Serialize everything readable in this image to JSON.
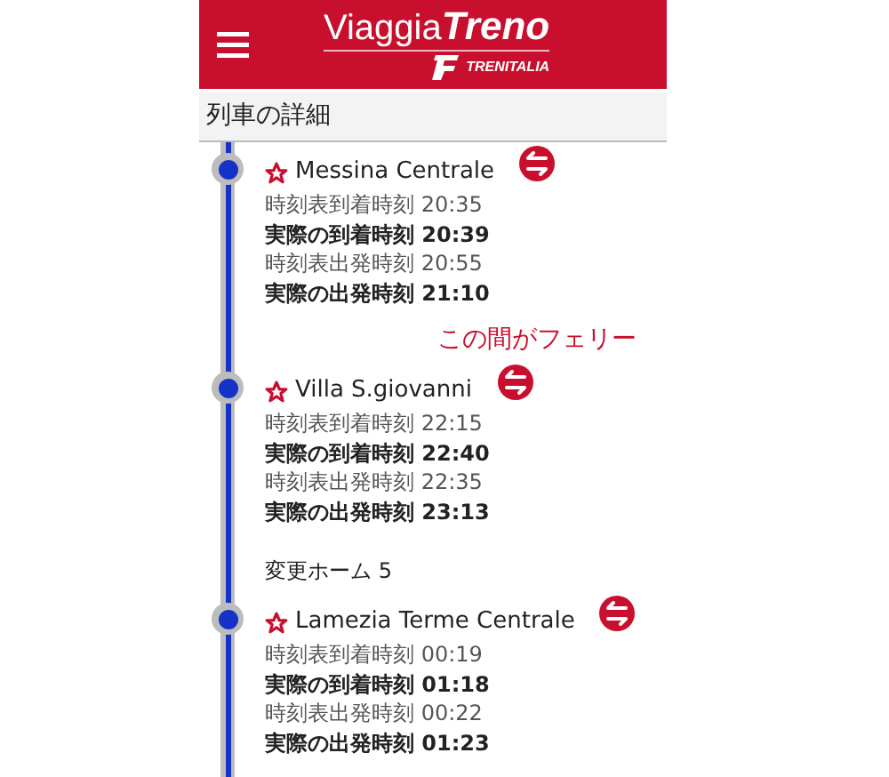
{
  "header": {
    "logo_main": "Viaggia",
    "logo_bold": "Treno",
    "logo_sub": "TRENITALIA"
  },
  "section_title": "列車の詳細",
  "stops": [
    {
      "name": "Messina Centrale",
      "lines": [
        {
          "kind": "scheduled",
          "text": "時刻表到着時刻 20:35"
        },
        {
          "kind": "actual",
          "text": "実際の到着時刻 20:39"
        },
        {
          "kind": "scheduled",
          "text": "時刻表出発時刻 20:55"
        },
        {
          "kind": "actual",
          "text": "実際の出発時刻 21:10"
        }
      ],
      "note": "この間がフェリー"
    },
    {
      "name": "Villa S.giovanni",
      "lines": [
        {
          "kind": "scheduled",
          "text": "時刻表到着時刻 22:15"
        },
        {
          "kind": "actual",
          "text": "実際の到着時刻 22:40"
        },
        {
          "kind": "scheduled",
          "text": "時刻表出発時刻 22:35"
        },
        {
          "kind": "actual",
          "text": "実際の出発時刻 23:13"
        }
      ],
      "platform": "変更ホーム 5"
    },
    {
      "name": "Lamezia Terme Centrale",
      "lines": [
        {
          "kind": "scheduled",
          "text": "時刻表到着時刻 00:19"
        },
        {
          "kind": "actual",
          "text": "実際の到着時刻 01:18"
        },
        {
          "kind": "scheduled",
          "text": "時刻表出発時刻 00:22"
        },
        {
          "kind": "actual",
          "text": "実際の出発時刻 01:23"
        }
      ]
    }
  ]
}
